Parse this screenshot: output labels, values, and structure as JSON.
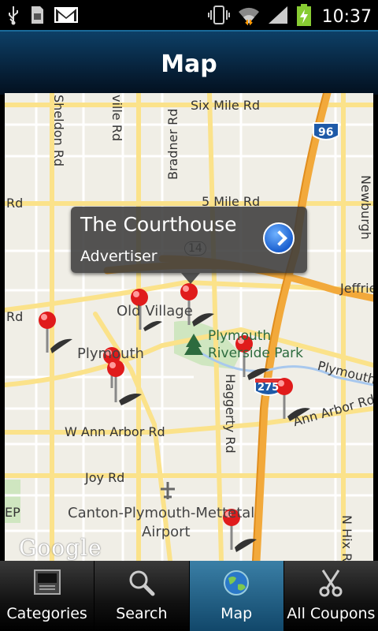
{
  "statusbar": {
    "time": "10:37",
    "icons": [
      "usb-icon",
      "sd-card-icon",
      "gmail-icon",
      "vibrate-icon",
      "wifi-icon",
      "signal-icon",
      "battery-charging-icon"
    ]
  },
  "header": {
    "title": "Map"
  },
  "map": {
    "labels": {
      "six_mile": "Six Mile Rd",
      "five_mile": "5 Mile Rd",
      "sheldon": "Sheldon Rd",
      "beck": "ville Rd",
      "bradner": "Bradner Rd",
      "newburgh": "Newburgh",
      "rd_left_top": "Rd",
      "rd_left_mid": "Rd",
      "jeffries": "Jeffrie",
      "old_village": "Old Village",
      "plymouth": "Plymouth",
      "plymouth_park_1": "Plymouth",
      "plymouth_park_2": "Riverside Park",
      "plymouth_rd": "Plymouth",
      "ann_arbor_rd": "Ann Arbor Rd",
      "w_ann_arbor_rd": "W Ann Arbor Rd",
      "joy_rd": "Joy Rd",
      "haggerty": "Haggerty Rd",
      "canton_airport_1": "Canton-Plymouth-Mettetal",
      "canton_airport_2": "Airport",
      "n_hix": "N Hix R",
      "ep": "EP",
      "hwy_96": "96",
      "hwy_275": "275",
      "hwy_14": "14"
    },
    "watermark": "Google",
    "popup": {
      "title": "The Courthouse",
      "subtitle": "Advertiser"
    }
  },
  "tabs": [
    {
      "label": "Categories",
      "icon": "categories-icon",
      "active": false
    },
    {
      "label": "Search",
      "icon": "search-icon",
      "active": false
    },
    {
      "label": "Map",
      "icon": "globe-icon",
      "active": true
    },
    {
      "label": "All Coupons",
      "icon": "scissors-icon",
      "active": false
    }
  ]
}
